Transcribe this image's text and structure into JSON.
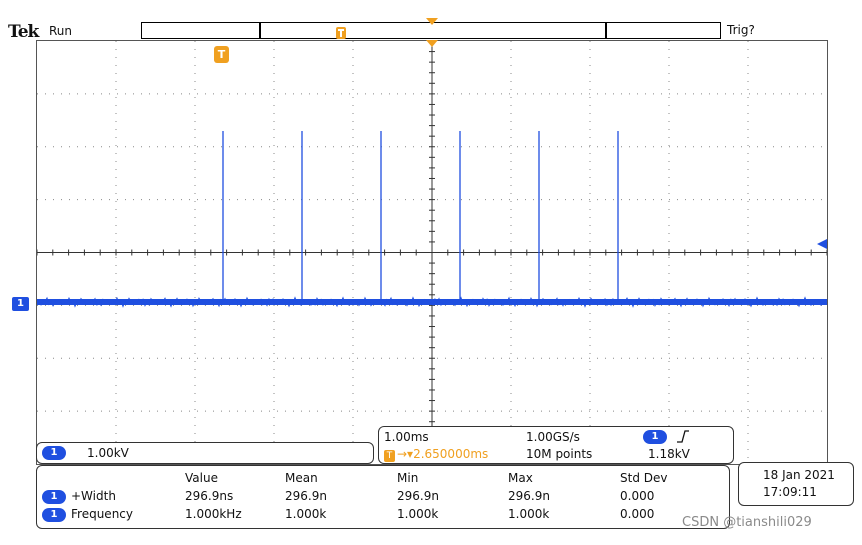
{
  "header": {
    "brand": "Tek",
    "status": "Run",
    "trigger_status": "Trig?"
  },
  "channel": {
    "number": "1",
    "scale": "1.00kV",
    "color": "#1f4fe0"
  },
  "trigger_marker": {
    "label": "T",
    "color": "#f0a020"
  },
  "horizontal": {
    "time_per_div": "1.00ms",
    "sample_rate": "1.00GS/s",
    "trigger_position": "2.650000ms",
    "record_length": "10M points",
    "trigger_channel": "1",
    "trigger_slope_icon": "rising-edge-icon",
    "trigger_level": "1.18kV"
  },
  "measurements": {
    "headers": [
      "Value",
      "Mean",
      "Min",
      "Max",
      "Std Dev"
    ],
    "rows": [
      {
        "channel": "1",
        "name": "+Width",
        "values": [
          "296.9ns",
          "296.9n",
          "296.9n",
          "296.9n",
          "0.000"
        ]
      },
      {
        "channel": "1",
        "name": "Frequency",
        "values": [
          "1.000kHz",
          "1.000k",
          "1.000k",
          "1.000k",
          "0.000"
        ]
      }
    ]
  },
  "datetime": {
    "date": "18 Jan  2021",
    "time": "17:09:11"
  },
  "watermark": "CSDN @tianshili029",
  "waveform": {
    "pulse_count": 6,
    "pulse_period_ms": 1.0,
    "colors": {
      "trace": "#1f4fe0",
      "grid": "#333333",
      "trigger_level": "#1f4fe0"
    }
  }
}
